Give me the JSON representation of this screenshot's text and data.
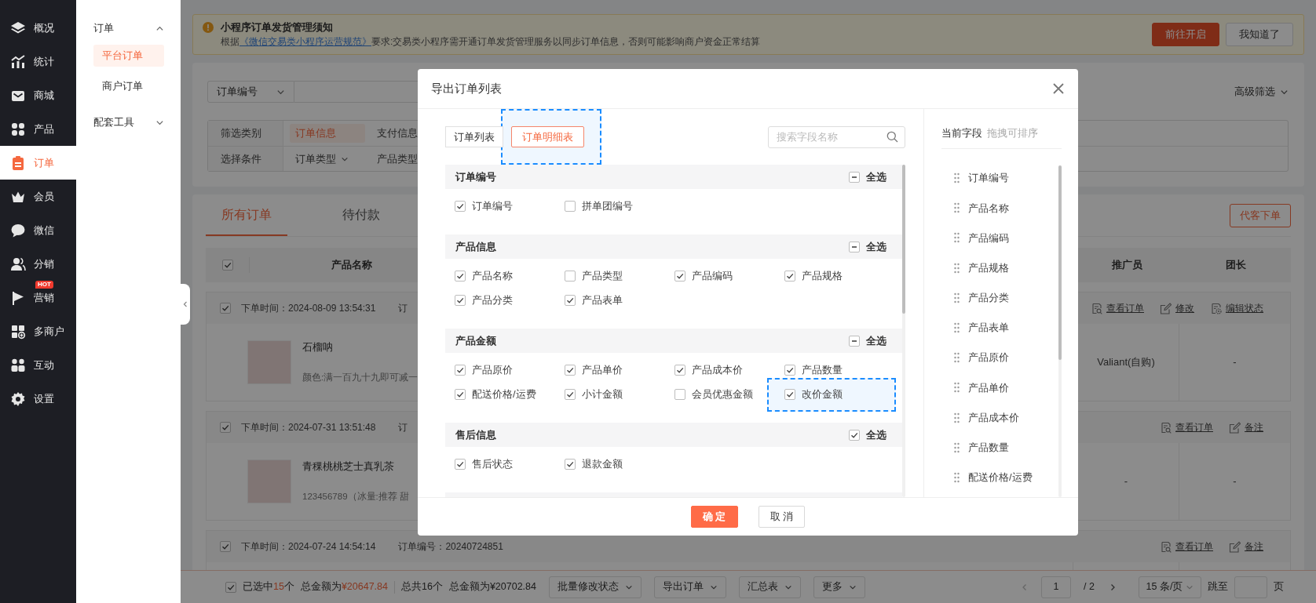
{
  "sidebar": {
    "items": [
      {
        "label": "概况",
        "selected": false
      },
      {
        "label": "统计",
        "selected": false
      },
      {
        "label": "商城",
        "selected": false
      },
      {
        "label": "产品",
        "selected": false
      },
      {
        "label": "订单",
        "selected": true
      },
      {
        "label": "会员",
        "selected": false
      },
      {
        "label": "微信",
        "selected": false
      },
      {
        "label": "分销",
        "selected": false
      },
      {
        "label": "营销",
        "selected": false,
        "badge": "HOT"
      },
      {
        "label": "多商户",
        "selected": false
      },
      {
        "label": "互动",
        "selected": false
      },
      {
        "label": "设置",
        "selected": false
      }
    ]
  },
  "submenu": [
    {
      "label": "订单",
      "expanded": true,
      "children": [
        {
          "label": "平台订单",
          "selected": true
        },
        {
          "label": "商户订单",
          "selected": false
        }
      ]
    },
    {
      "label": "配套工具",
      "expanded": false
    }
  ],
  "notice": {
    "title": "小程序订单发货管理须知",
    "text_before": "根据",
    "link": "《微信交易类小程序运营规范》",
    "text_after": "要求:交易类小程序需开通订单发货管理服务以同步订单信息，否则可能影响商户资金正常结算",
    "buttons": [
      {
        "label": "前往开启",
        "kind": "primary"
      },
      {
        "label": "我知道了",
        "kind": "default"
      }
    ]
  },
  "filter": {
    "search_select": "订单编号",
    "advanced": "高级筛选",
    "rows": [
      {
        "label": "筛选类别",
        "options": [
          {
            "label": "订单信息",
            "selected": true,
            "dropdown": false
          },
          {
            "label": "支付信息",
            "selected": false,
            "dropdown": false
          }
        ]
      },
      {
        "label": "选择条件",
        "options": [
          {
            "label": "订单类型",
            "selected": false,
            "dropdown": true
          },
          {
            "label": "产品类型",
            "selected": false,
            "dropdown": false
          }
        ]
      }
    ]
  },
  "order_tabs": [
    {
      "label": "所有订单",
      "selected": true
    },
    {
      "label": "待付款",
      "selected": false
    }
  ],
  "proxy_order_button": "代客下单",
  "table": {
    "header_checked": true,
    "columns": [
      "产品名称",
      "推广员",
      "团长"
    ],
    "orders": [
      {
        "checked": true,
        "time": "下单时间：2024-08-09 13:54:31",
        "order_no": "订",
        "actions": [
          {
            "label": "查看订单",
            "kind": "view"
          },
          {
            "label": "修改",
            "kind": "edit"
          },
          {
            "label": "编辑状态",
            "kind": "status"
          }
        ],
        "product": {
          "name": "石榴呐",
          "spec": "颜色:满一百九十九即可减一"
        },
        "promoter": "Valiant(自购)",
        "leader": "-"
      },
      {
        "checked": true,
        "time": "下单时间：2024-07-31 13:51:48",
        "order_no": "订",
        "actions": [
          {
            "label": "查看订单",
            "kind": "view"
          },
          {
            "label": "备注",
            "kind": "edit"
          }
        ],
        "product": {
          "name": "青稞桃桃芝士真乳茶",
          "spec": "123456789（冰量:推荐 甜"
        },
        "promoter": "-",
        "leader": "-"
      },
      {
        "checked": true,
        "time": "下单时间：2024-07-24 14:54:14",
        "order_no": "订单编号：20240724851",
        "actions": [
          {
            "label": "查看订单",
            "kind": "view"
          },
          {
            "label": "备注",
            "kind": "edit"
          }
        ]
      }
    ]
  },
  "footer": {
    "checked": true,
    "selected_text": "已选中",
    "selected_count": "15",
    "selected_unit": "个",
    "selected_amount_label": "总金额为",
    "selected_amount": "¥20647.84",
    "total_text": "总共16个",
    "total_amount": "总金额为¥20702.84",
    "menus": [
      "批量修改状态",
      "导出订单",
      "汇总表",
      "更多"
    ],
    "page": "1",
    "pages": "/ 2",
    "page_size": "15 条/页",
    "jump_label": "跳至",
    "page_unit": "页"
  },
  "dialog": {
    "title": "导出订单列表",
    "tabs": [
      {
        "label": "订单列表",
        "selected": false,
        "highlighted": false
      },
      {
        "label": "订单明细表",
        "selected": true,
        "highlighted": true
      }
    ],
    "search": {
      "placeholder": "搜索字段名称"
    },
    "groups": [
      {
        "title": "订单编号",
        "select_all_checked": true,
        "select_all_partial": true,
        "select_all_label": "全选",
        "fields": [
          {
            "label": "订单编号",
            "checked": true,
            "highlighted": false
          },
          {
            "label": "拼单团编号",
            "checked": false,
            "highlighted": false
          }
        ]
      },
      {
        "title": "产品信息",
        "select_all_checked": true,
        "select_all_partial": true,
        "select_all_label": "全选",
        "fields": [
          {
            "label": "产品名称",
            "checked": true,
            "highlighted": false
          },
          {
            "label": "产品类型",
            "checked": false,
            "highlighted": false
          },
          {
            "label": "产品编码",
            "checked": true,
            "highlighted": false
          },
          {
            "label": "产品规格",
            "checked": true,
            "highlighted": false
          },
          {
            "label": "产品分类",
            "checked": true,
            "highlighted": false
          },
          {
            "label": "产品表单",
            "checked": true,
            "highlighted": false
          }
        ]
      },
      {
        "title": "产品金额",
        "select_all_checked": true,
        "select_all_partial": true,
        "select_all_label": "全选",
        "fields": [
          {
            "label": "产品原价",
            "checked": true,
            "highlighted": false
          },
          {
            "label": "产品单价",
            "checked": true,
            "highlighted": false
          },
          {
            "label": "产品成本价",
            "checked": true,
            "highlighted": false
          },
          {
            "label": "产品数量",
            "checked": true,
            "highlighted": false
          },
          {
            "label": "配送价格/运费",
            "checked": true,
            "highlighted": false
          },
          {
            "label": "小计金额",
            "checked": true,
            "highlighted": false
          },
          {
            "label": "会员优惠金额",
            "checked": false,
            "highlighted": false
          },
          {
            "label": "改价金额",
            "checked": true,
            "highlighted": true
          }
        ]
      },
      {
        "title": "售后信息",
        "select_all_checked": true,
        "select_all_partial": false,
        "select_all_label": "全选",
        "fields": [
          {
            "label": "售后状态",
            "checked": true,
            "highlighted": false
          },
          {
            "label": "退款金额",
            "checked": true,
            "highlighted": false
          }
        ]
      }
    ],
    "current_fields": {
      "title": "当前字段",
      "hint": "拖拽可排序",
      "items": [
        "订单编号",
        "产品名称",
        "产品编码",
        "产品规格",
        "产品分类",
        "产品表单",
        "产品原价",
        "产品单价",
        "产品成本价",
        "产品数量",
        "配送价格/运费"
      ]
    },
    "buttons": [
      {
        "label": "确 定",
        "kind": "primary"
      },
      {
        "label": "取 消",
        "kind": "default"
      }
    ]
  }
}
